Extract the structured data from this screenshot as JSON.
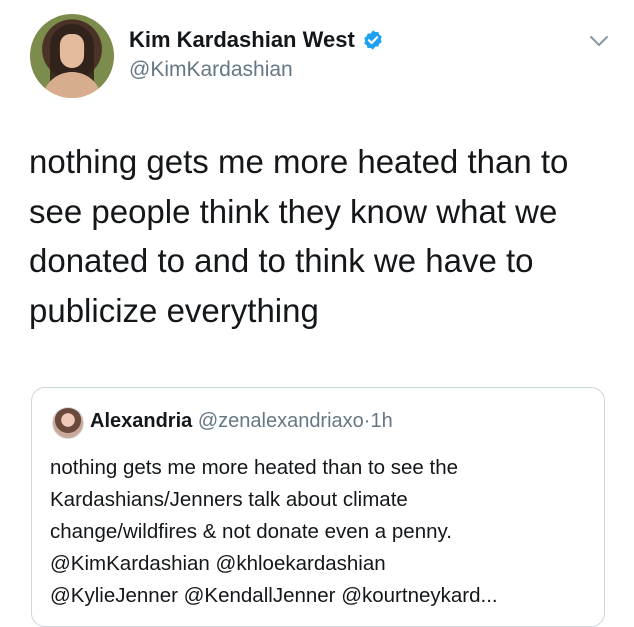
{
  "tweet": {
    "author": {
      "display_name": "Kim Kardashian West",
      "handle": "@KimKardashian",
      "verified": true,
      "verified_color": "#1da1f2"
    },
    "text": "nothing gets me more heated than to\nsee people think they know what we\ndonated to and to think we have to\npublicize everything",
    "menu_icon": "chevron-down-icon"
  },
  "quoted_tweet": {
    "author": {
      "display_name": "Alexandria",
      "handle": "@zenalexandriaxo",
      "separator": "·",
      "time": "1h"
    },
    "text": "nothing gets me more heated than to see the\nKardashians/Jenners talk about climate\nchange/wildfires & not donate even a penny.\n@KimKardashian @khloekardashian\n@KylieJenner @KendallJenner @kourtneykard..."
  }
}
